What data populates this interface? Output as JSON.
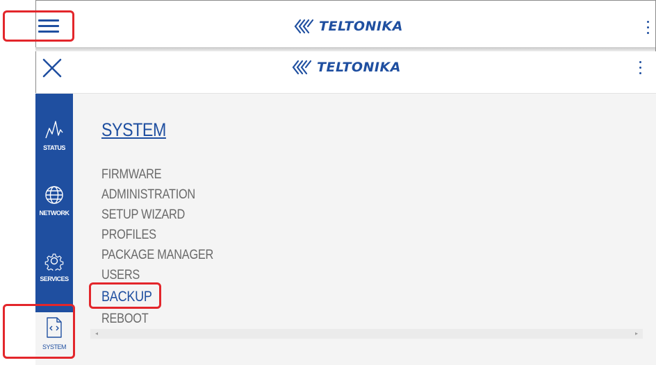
{
  "header": {
    "brand": "TELTONIKA",
    "menu_icon": "hamburger-icon",
    "more_icon": "kebab-menu-icon"
  },
  "drawer": {
    "brand": "TELTONIKA",
    "close_icon": "close-icon",
    "more_icon": "kebab-menu-icon"
  },
  "sidebar": {
    "items": [
      {
        "label": "STATUS",
        "icon": "activity-icon"
      },
      {
        "label": "NETWORK",
        "icon": "globe-icon"
      },
      {
        "label": "SERVICES",
        "icon": "gear-icon"
      },
      {
        "label": "SYSTEM",
        "icon": "code-file-icon"
      }
    ]
  },
  "main": {
    "section_title": "SYSTEM",
    "links": [
      "FIRMWARE",
      "ADMINISTRATION",
      "SETUP WIZARD",
      "PROFILES",
      "PACKAGE MANAGER",
      "USERS",
      "BACKUP",
      "REBOOT"
    ]
  },
  "scrollbar": {
    "left": "◂",
    "right": "▸"
  },
  "colors": {
    "brand_blue": "#1f4fa0",
    "highlight_red": "#e3262b",
    "link_gray": "#6a6a6a",
    "content_bg": "#f4f4f4"
  }
}
